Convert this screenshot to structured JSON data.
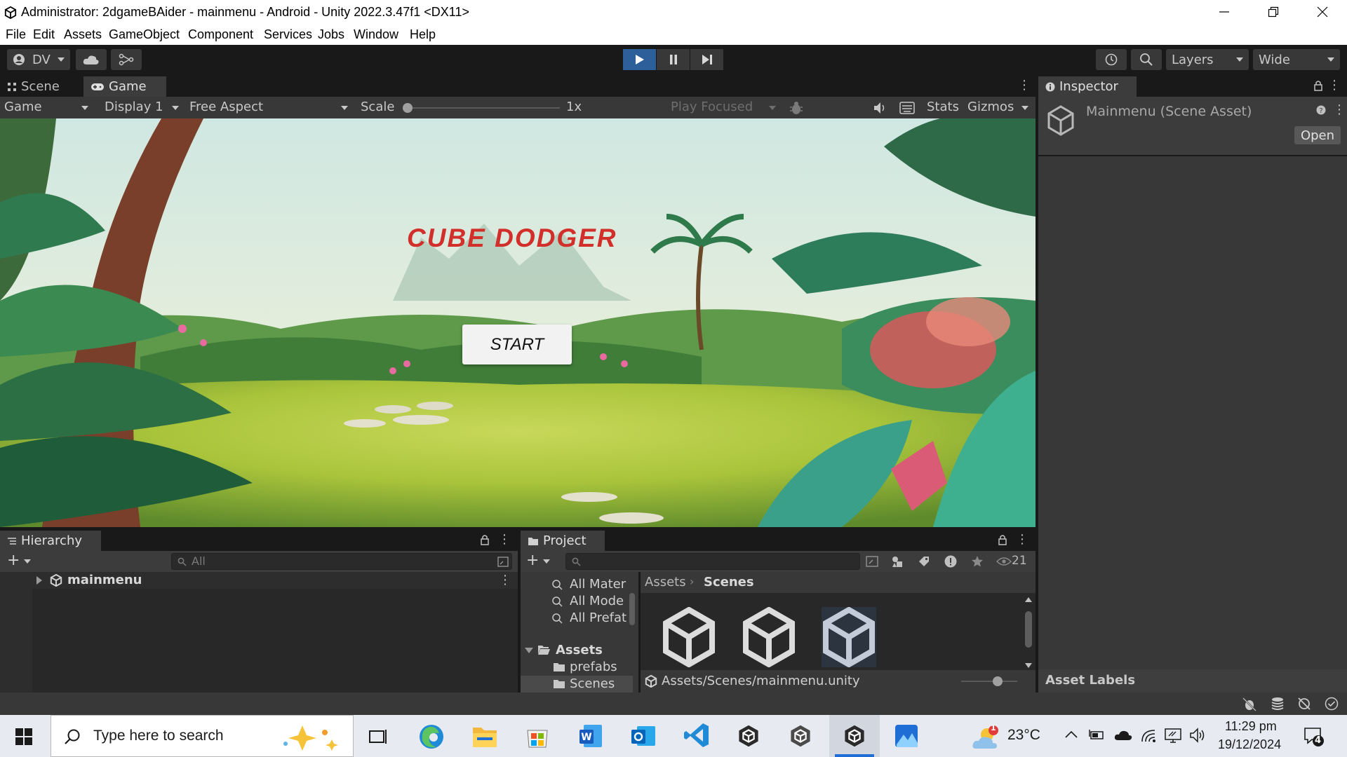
{
  "window": {
    "title": "Administrator: 2dgameBAider - mainmenu - Android - Unity 2022.3.47f1 <DX11>"
  },
  "menubar": [
    "File",
    "Edit",
    "Assets",
    "GameObject",
    "Component",
    "Services",
    "Jobs",
    "Window",
    "Help"
  ],
  "toolbar": {
    "account_label": "DV",
    "layers_label": "Layers",
    "layout_label": "Wide"
  },
  "tabs": {
    "scene": "Scene",
    "game": "Game",
    "inspector": "Inspector",
    "hierarchy": "Hierarchy",
    "project": "Project"
  },
  "game_toolbar": {
    "mode": "Game",
    "display": "Display 1",
    "aspect": "Free Aspect",
    "scale_label": "Scale",
    "scale_value": "1x",
    "play_focused": "Play Focused",
    "stats": "Stats",
    "gizmos": "Gizmos"
  },
  "game": {
    "title": "CUBE DODGER",
    "start_button": "START"
  },
  "inspector": {
    "asset_title": "Mainmenu (Scene Asset)",
    "open_button": "Open",
    "asset_labels": "Asset Labels"
  },
  "hierarchy": {
    "search_placeholder": "All",
    "scene_name": "mainmenu"
  },
  "project": {
    "favorites": [
      "All Mater",
      "All Mode",
      "All Prefat"
    ],
    "root": "Assets",
    "folders": [
      "prefabs",
      "Scenes"
    ],
    "breadcrumb": [
      "Assets",
      "Scenes"
    ],
    "visible_count": "21",
    "selected_path": "Assets/Scenes/mainmenu.unity"
  },
  "taskbar": {
    "search_placeholder": "Type here to search",
    "weather": "23°C",
    "weather_badge": "1",
    "time": "11:29 pm",
    "date": "19/12/2024",
    "notification_count": "4"
  }
}
